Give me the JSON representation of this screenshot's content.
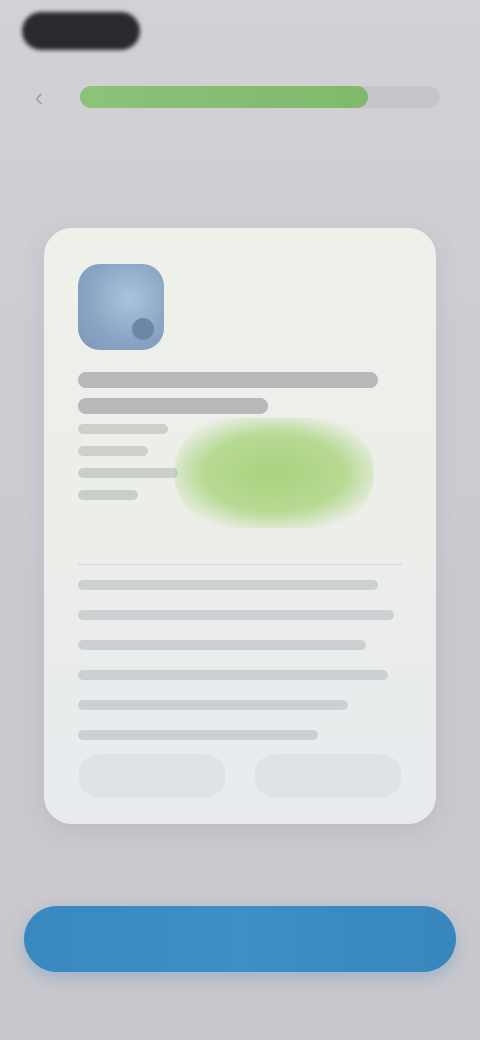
{
  "status_bar": {
    "pill": ""
  },
  "nav": {
    "back_icon": "chevron-left-icon",
    "back_glyph": "‹",
    "progress": 0.8
  },
  "card": {
    "icon": "app-icon",
    "title": "",
    "secondary_button": "",
    "tertiary_button": ""
  },
  "footer": {
    "primary_button": ""
  },
  "colors": {
    "accent_green": "#8ec27a",
    "primary_blue": "#3d8fc6",
    "card_bg": "#eef0ea"
  }
}
